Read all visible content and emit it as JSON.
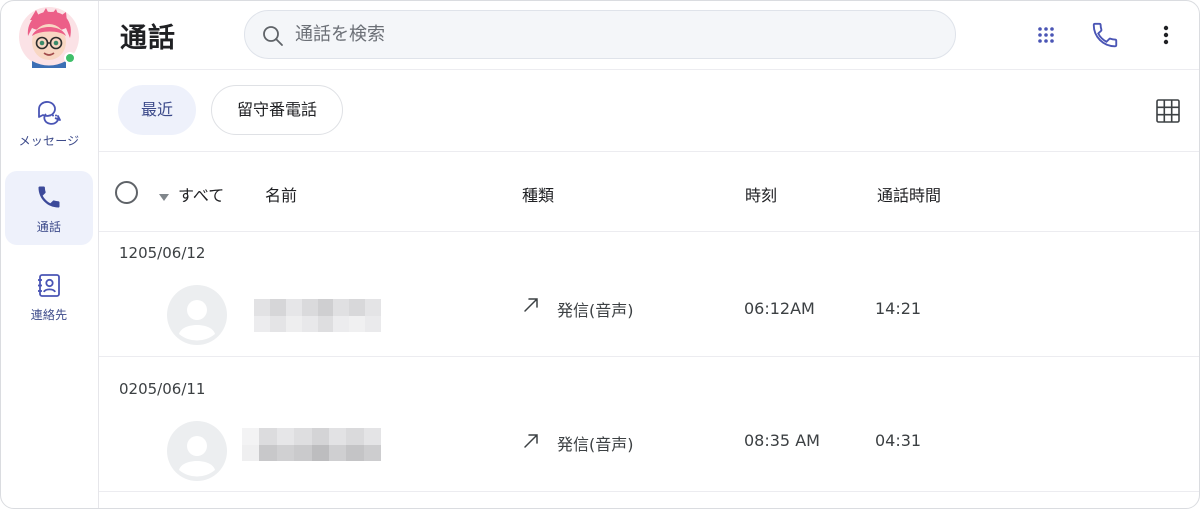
{
  "sidebar": {
    "items": [
      {
        "label": "メッセージ",
        "icon": "chat-bubbles-icon",
        "active": false
      },
      {
        "label": "通話",
        "icon": "phone-icon",
        "active": true
      },
      {
        "label": "連絡先",
        "icon": "contacts-icon",
        "active": false
      }
    ],
    "status_color": "#3fbf6a"
  },
  "header": {
    "title": "通話",
    "search": {
      "placeholder": "通話を検索",
      "value": ""
    },
    "buttons": [
      "dialpad-icon",
      "phone-icon",
      "more-vert-icon"
    ]
  },
  "tabs": [
    {
      "label": "最近",
      "active": true
    },
    {
      "label": "留守番電話",
      "active": false
    }
  ],
  "columns": {
    "select_all": "すべて",
    "name": "名前",
    "type": "種類",
    "time": "時刻",
    "duration": "通話時間"
  },
  "groups": [
    {
      "date": "1205/06/12",
      "calls": [
        {
          "type": "発信(音声)",
          "time": "06:12AM",
          "duration": "14:21"
        }
      ]
    },
    {
      "date": "0205/06/11",
      "calls": [
        {
          "type": "発信(音声)",
          "time": "08:35 AM",
          "duration": "04:31"
        }
      ]
    }
  ],
  "colors": {
    "accent": "#3c4a8a",
    "active_bg": "#eef1fb",
    "icon_blue": "#4a55b5"
  }
}
